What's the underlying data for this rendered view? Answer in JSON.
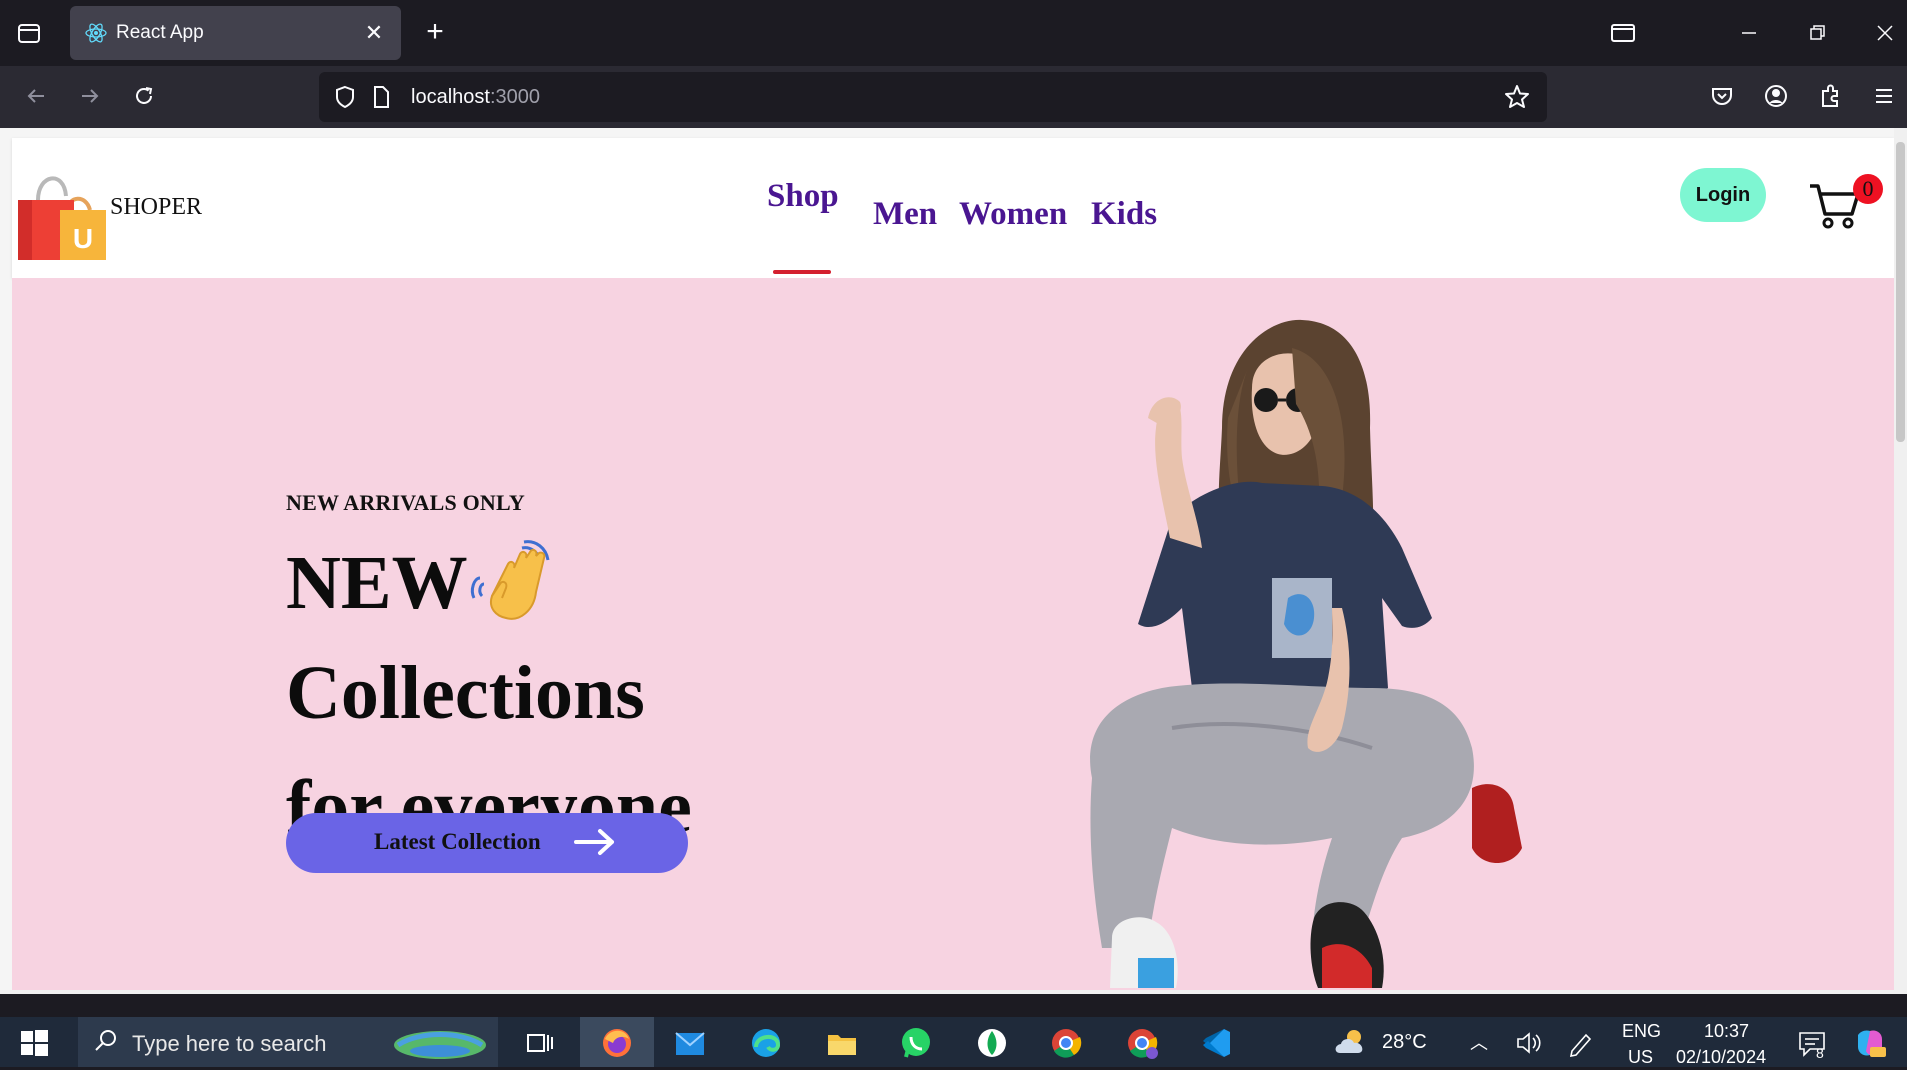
{
  "browser": {
    "tab_title": "React App",
    "url_host": "localhost",
    "url_port": ":3000"
  },
  "site": {
    "logo_text": "SHOPER",
    "nav": [
      "Shop",
      "Men",
      "Women",
      "Kids"
    ],
    "active_nav": "Shop",
    "login_label": "Login",
    "cart_count": "0"
  },
  "hero": {
    "subtitle": "NEW ARRIVALS ONLY",
    "line1": "NEW",
    "line2": "Collections",
    "line3": "for everyone",
    "cta_label": "Latest Collection"
  },
  "taskbar": {
    "search_placeholder": "Type here to search",
    "weather": "28°C",
    "lang_line1": "ENG",
    "lang_line2": "US",
    "time": "10:37",
    "date": "02/10/2024",
    "notification_count": "8"
  },
  "colors": {
    "nav_text": "#4a1691",
    "hero_bg": "#f7d3e1",
    "cta_bg": "#6a64e6",
    "login_bg": "#7ef6d2",
    "active_underline": "#d41f2e",
    "cart_badge": "#ee1122"
  }
}
